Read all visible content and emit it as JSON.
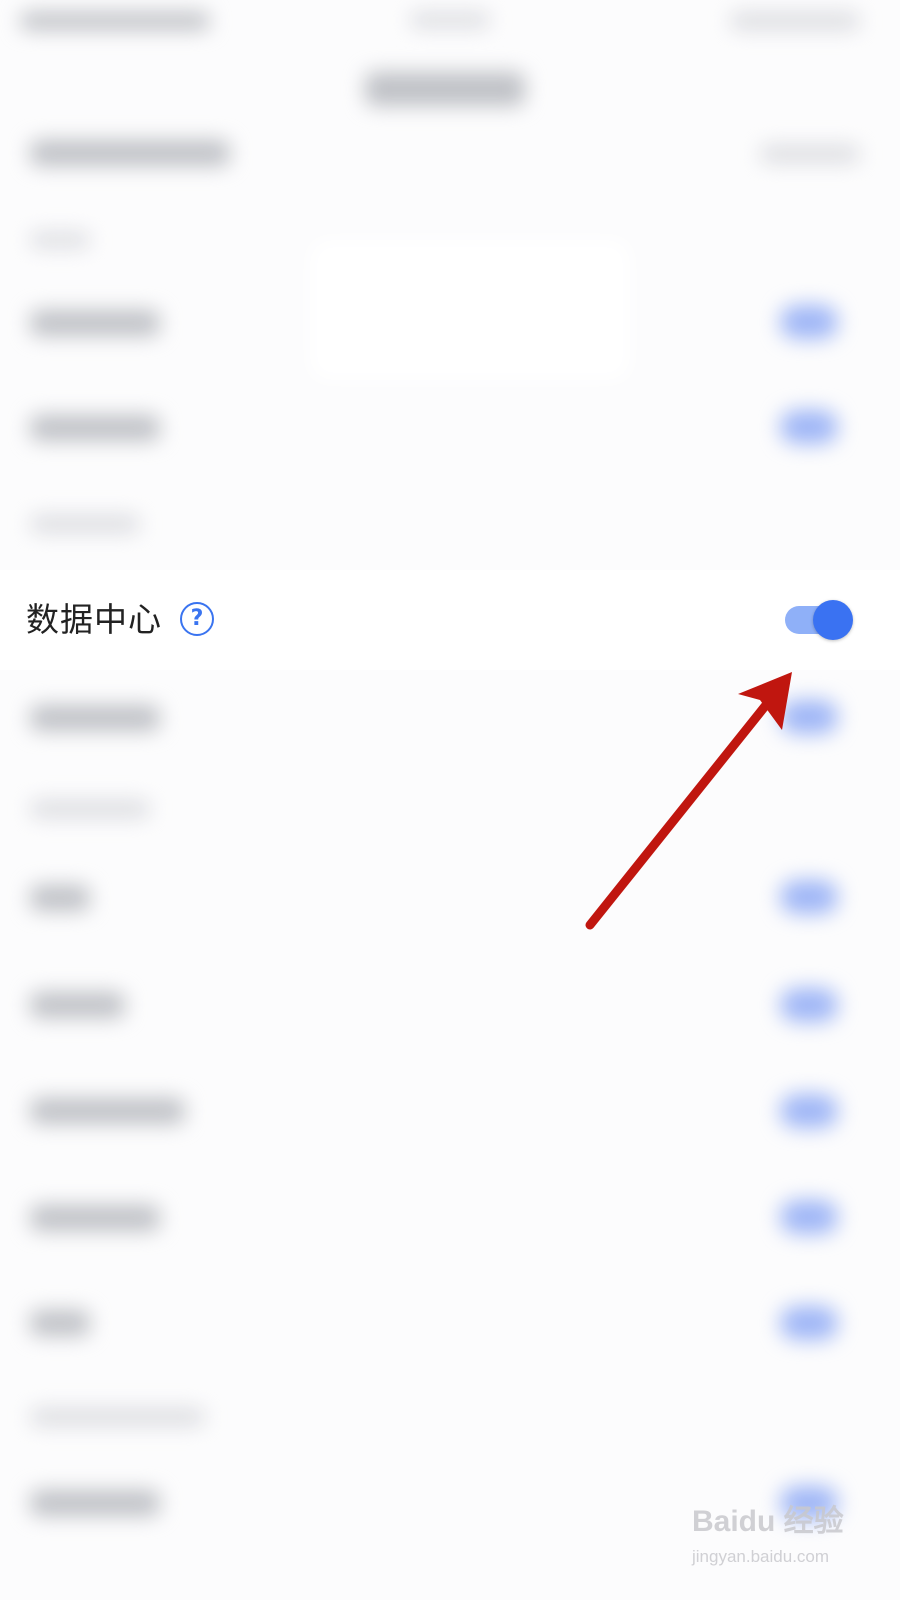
{
  "setting": {
    "label": "数据中心",
    "help_icon": "question-circle-icon",
    "help_glyph": "?",
    "toggle_state": "on"
  },
  "colors": {
    "accent": "#3a72f2",
    "toggle_track": "#8fb0f8",
    "annotation_arrow": "#c0160f",
    "background": "#fcfcfd"
  },
  "watermark": {
    "main": "Baidu 经验",
    "sub": "jingyan.baidu.com"
  }
}
